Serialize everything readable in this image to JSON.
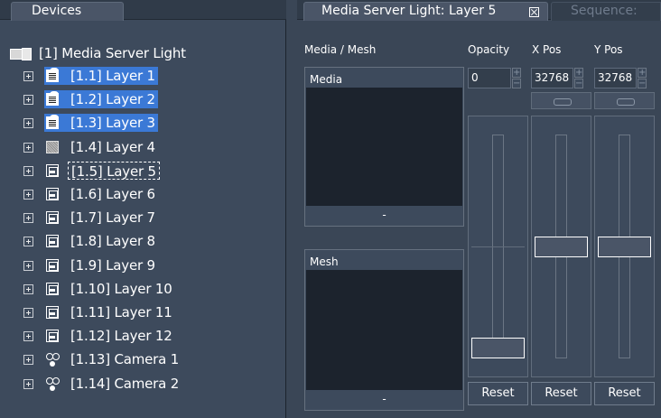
{
  "devices_panel": {
    "tab_label": "Devices",
    "root_label": "[1] Media Server Light",
    "items": [
      {
        "label": "[1.1] Layer 1",
        "icon": "lock-icon",
        "selected": true
      },
      {
        "label": "[1.2] Layer 2",
        "icon": "lock-icon",
        "selected": true
      },
      {
        "label": "[1.3] Layer 3",
        "icon": "lock-icon",
        "selected": true
      },
      {
        "label": "[1.4] Layer 4",
        "icon": "grey-layer-icon",
        "selected": false
      },
      {
        "label": "[1.5] Layer 5",
        "icon": "image-layer-icon",
        "selected": false,
        "focused": true
      },
      {
        "label": "[1.6] Layer 6",
        "icon": "image-layer-icon",
        "selected": false
      },
      {
        "label": "[1.7] Layer 7",
        "icon": "image-layer-icon",
        "selected": false
      },
      {
        "label": "[1.8] Layer 8",
        "icon": "image-layer-icon",
        "selected": false
      },
      {
        "label": "[1.9] Layer 9",
        "icon": "image-layer-icon",
        "selected": false
      },
      {
        "label": "[1.10] Layer 10",
        "icon": "image-layer-icon",
        "selected": false
      },
      {
        "label": "[1.11] Layer 11",
        "icon": "image-layer-icon",
        "selected": false
      },
      {
        "label": "[1.12] Layer 12",
        "icon": "image-layer-icon",
        "selected": false
      },
      {
        "label": "[1.13] Camera 1",
        "icon": "camera-icon",
        "selected": false
      },
      {
        "label": "[1.14] Camera 2",
        "icon": "camera-icon",
        "selected": false
      }
    ]
  },
  "layer_panel": {
    "tab_label": "Media Server Light: Layer 5",
    "sequence_tab_label": "Sequence:",
    "columns": {
      "media_mesh": "Media / Mesh",
      "opacity": "Opacity",
      "x_pos": "X Pos",
      "y_pos": "Y Pos"
    },
    "media_box": {
      "title": "Media",
      "value": "-"
    },
    "mesh_box": {
      "title": "Mesh",
      "value": "-"
    },
    "opacity": {
      "value": "0",
      "reset_label": "Reset",
      "slider_fraction": 0.0
    },
    "x_pos": {
      "value": "32768",
      "reset_label": "Reset",
      "slider_fraction": 0.5
    },
    "y_pos": {
      "value": "32768",
      "reset_label": "Reset",
      "slider_fraction": 0.5
    }
  },
  "colors": {
    "selection": "#3b79d6",
    "panel_background": "#3d4a5c",
    "preview_background": "#1c232d"
  }
}
